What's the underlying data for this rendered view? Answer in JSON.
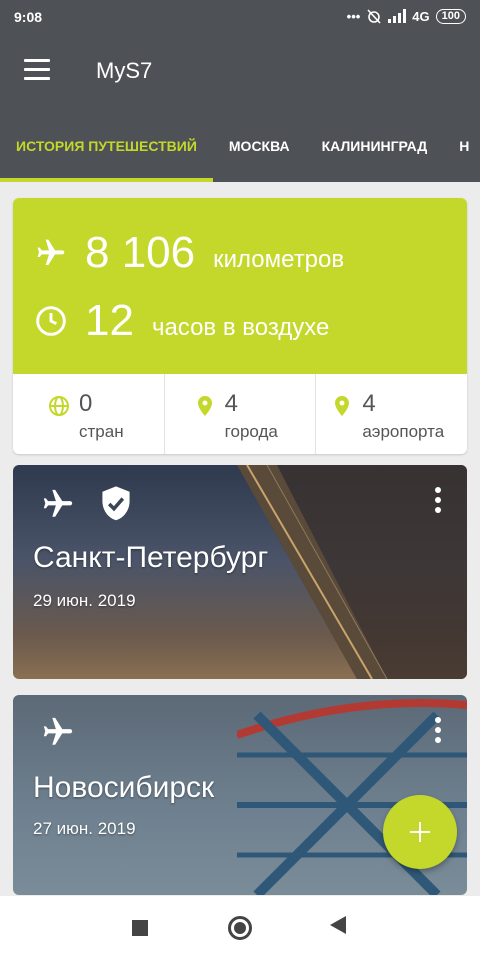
{
  "status_bar": {
    "time": "9:08",
    "indicators": "... ",
    "network": "4G",
    "battery": "100"
  },
  "app_bar": {
    "title": "MyS7",
    "menu_icon": "hamburger-menu-icon"
  },
  "tabs": [
    {
      "label": "ИСТОРИЯ ПУТЕШЕСТВИЙ",
      "active": true
    },
    {
      "label": "МОСКВА",
      "active": false
    },
    {
      "label": "КАЛИНИНГРАД",
      "active": false
    },
    {
      "label": "Н",
      "active": false
    }
  ],
  "summary": {
    "distance_value": "8 106",
    "distance_unit": "километров",
    "hours_value": "12",
    "hours_unit": "часов в воздухе",
    "countries_value": "0",
    "countries_label": "стран",
    "cities_value": "4",
    "cities_label": "города",
    "airports_value": "4",
    "airports_label": "аэропорта"
  },
  "trips": [
    {
      "city": "Санкт-Петербург",
      "date": "29 июн. 2019",
      "verified": true
    },
    {
      "city": "Новосибирск",
      "date": "27 июн. 2019",
      "verified": false
    }
  ],
  "fab": {
    "icon": "plus-icon"
  },
  "colors": {
    "accent": "#c3d82b",
    "appbar": "#4e5155"
  }
}
